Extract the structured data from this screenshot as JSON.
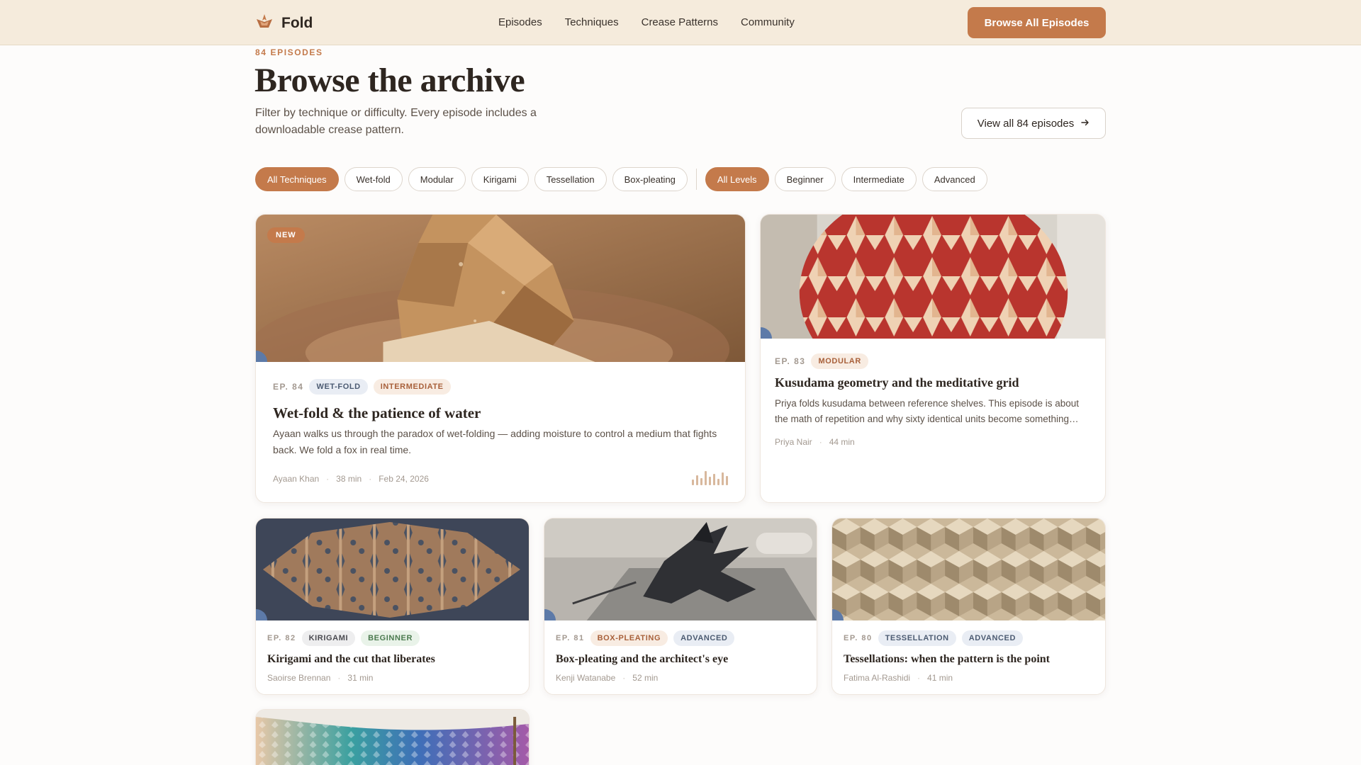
{
  "header": {
    "brand": "Fold",
    "nav": [
      "Episodes",
      "Techniques",
      "Crease Patterns",
      "Community"
    ],
    "cta": "Browse All Episodes"
  },
  "hero": {
    "eyebrow": "84 EPISODES",
    "title": "Browse the archive",
    "lede": "Filter by technique or difficulty. Every episode includes a downloadable crease pattern.",
    "view_all": "View all 84 episodes"
  },
  "filters": {
    "techniques": [
      "All Techniques",
      "Wet-fold",
      "Modular",
      "Kirigami",
      "Tessellation",
      "Box-pleating"
    ],
    "levels": [
      "All Levels",
      "Beginner",
      "Intermediate",
      "Advanced"
    ],
    "active_technique": "All Techniques",
    "active_level": "All Levels"
  },
  "episodes": [
    {
      "badge": "NEW",
      "ep": "EP. 84",
      "tags": [
        "WET-FOLD",
        "INTERMEDIATE"
      ],
      "title": "Wet-fold & the patience of water",
      "desc": "Ayaan walks us through the paradox of wet-folding — adding moisture to control a medium that fights back. We fold a fox in real time.",
      "author": "Ayaan Khan",
      "duration": "38 min",
      "date": "Feb 24, 2026"
    },
    {
      "ep": "EP. 83",
      "tags": [
        "MODULAR"
      ],
      "title": "Kusudama geometry and the meditative grid",
      "desc": "Priya folds kusudama between reference shelves. This episode is about the math of repetition and why sixty identical units become something…",
      "author": "Priya Nair",
      "duration": "44 min"
    },
    {
      "ep": "EP. 82",
      "tags": [
        "KIRIGAMI",
        "BEGINNER"
      ],
      "title": "Kirigami and the cut that liberates",
      "author": "Saoirse Brennan",
      "duration": "31 min"
    },
    {
      "ep": "EP. 81",
      "tags": [
        "BOX-PLEATING",
        "ADVANCED"
      ],
      "title": "Box-pleating and the architect's eye",
      "author": "Kenji Watanabe",
      "duration": "52 min"
    },
    {
      "ep": "EP. 80",
      "tags": [
        "TESSELLATION",
        "ADVANCED"
      ],
      "title": "Tessellations: when the pattern is the point",
      "author": "Fatima Al-Rashidi",
      "duration": "41 min"
    }
  ],
  "icons": {
    "brand": "folded-paper-logo-icon",
    "arrow": "arrow-right-icon",
    "audio": "audio-waveform-icon"
  },
  "colors": {
    "accent": "#c47a4b",
    "header_bg": "#f5ebdc"
  }
}
